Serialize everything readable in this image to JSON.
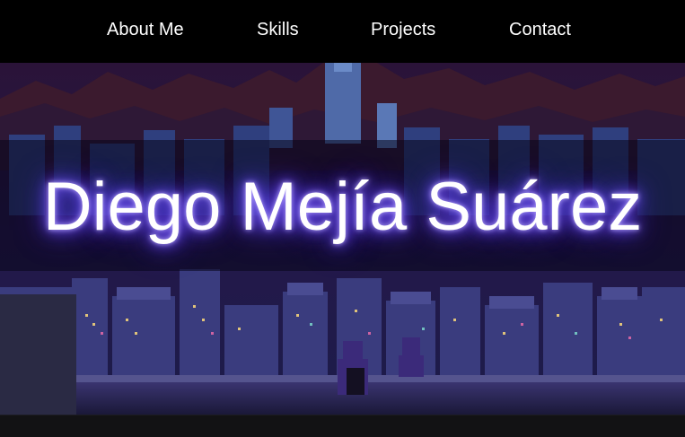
{
  "nav": {
    "items": [
      {
        "label": "About Me"
      },
      {
        "label": "Skills"
      },
      {
        "label": "Projects"
      },
      {
        "label": "Contact"
      }
    ]
  },
  "hero": {
    "title": "Diego Mejía Suárez",
    "background": "pixel-art night city skyline with two figures on a rooftop"
  },
  "colors": {
    "nav_background": "#000000",
    "sky": "#2a1338",
    "mountains": "#3b1a2e",
    "city": "#2b2a6a",
    "glow": "#7a5cff"
  }
}
